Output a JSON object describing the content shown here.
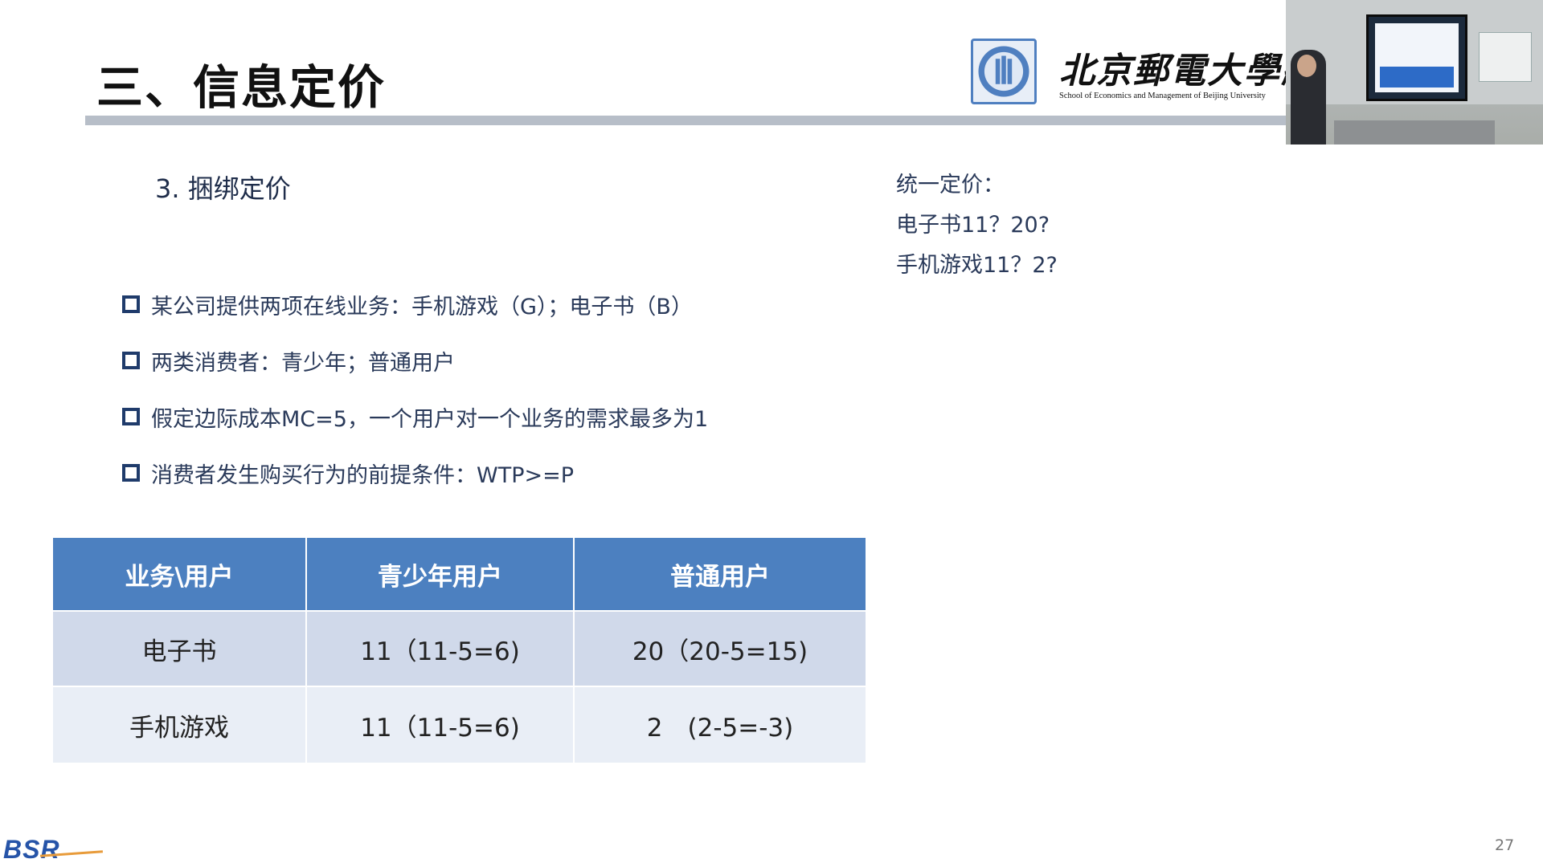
{
  "slide": {
    "title": "三、信息定价",
    "subheading": "3. 捆绑定价",
    "bullets": [
      "某公司提供两项在线业务：手机游戏（G）；电子书（B）",
      "两类消费者：青少年；普通用户",
      "假定边际成本MC=5，一个用户对一个业务的需求最多为1",
      "消费者发生购买行为的前提条件：WTP>=P"
    ],
    "notes": [
      "统一定价：",
      "电子书11？20?",
      "手机游戏11？2?"
    ],
    "table": {
      "headers": [
        "业务\\用户",
        "青少年用户",
        "普通用户"
      ],
      "rows": [
        [
          "电子书",
          "11（11-5=6)",
          "20（20-5=15)"
        ],
        [
          "手机游戏",
          "11（11-5=6)",
          "2　(2-5=-3)"
        ]
      ]
    },
    "page_number": "27"
  },
  "logo": {
    "university_cn": "北京郵電大學經濟",
    "university_en": "School of Economics and Management of Beijing University"
  },
  "footer": {
    "brand": "BSR"
  },
  "colors": {
    "header_fill": "#4c80c0",
    "row_fill_1": "#d0d9ea",
    "row_fill_2": "#e9eef6",
    "title_bar": "#b7bec8",
    "bullet_icon": "#1f3b6b"
  },
  "icons": {
    "bullet": "hollow-square-icon",
    "seal": "university-seal-icon"
  }
}
